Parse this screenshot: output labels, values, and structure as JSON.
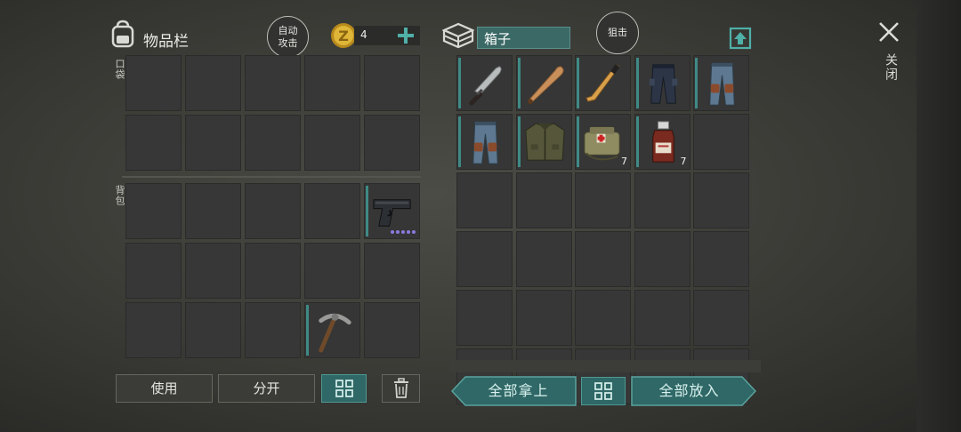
{
  "inventory": {
    "title": "物品栏",
    "auto_attack": "自动\n攻击",
    "coins": "4",
    "pocket_label": "口袋",
    "backpack_label": "背包",
    "pistol_durability_dots": 5
  },
  "container": {
    "name": "箱子",
    "snipe": "狙击",
    "items": [
      {
        "icon": "machete-icon"
      },
      {
        "icon": "baseball-bat-icon"
      },
      {
        "icon": "hockey-stick-icon"
      },
      {
        "icon": "dark-pants-icon"
      },
      {
        "icon": "kneepad-jeans-icon"
      },
      {
        "icon": "kneepad-jeans-icon"
      },
      {
        "icon": "jacket-icon"
      },
      {
        "icon": "first-aid-bag-icon",
        "count": "7"
      },
      {
        "icon": "medicine-bottle-icon",
        "count": "7"
      }
    ]
  },
  "close": {
    "label": "关闭"
  },
  "buttons": {
    "use": "使用",
    "split": "分开",
    "take_all": "全部拿上",
    "put_all": "全部放入"
  },
  "colors": {
    "accent": "#3f8a86",
    "teal_button": "#2f6866",
    "slot": "#353635"
  }
}
